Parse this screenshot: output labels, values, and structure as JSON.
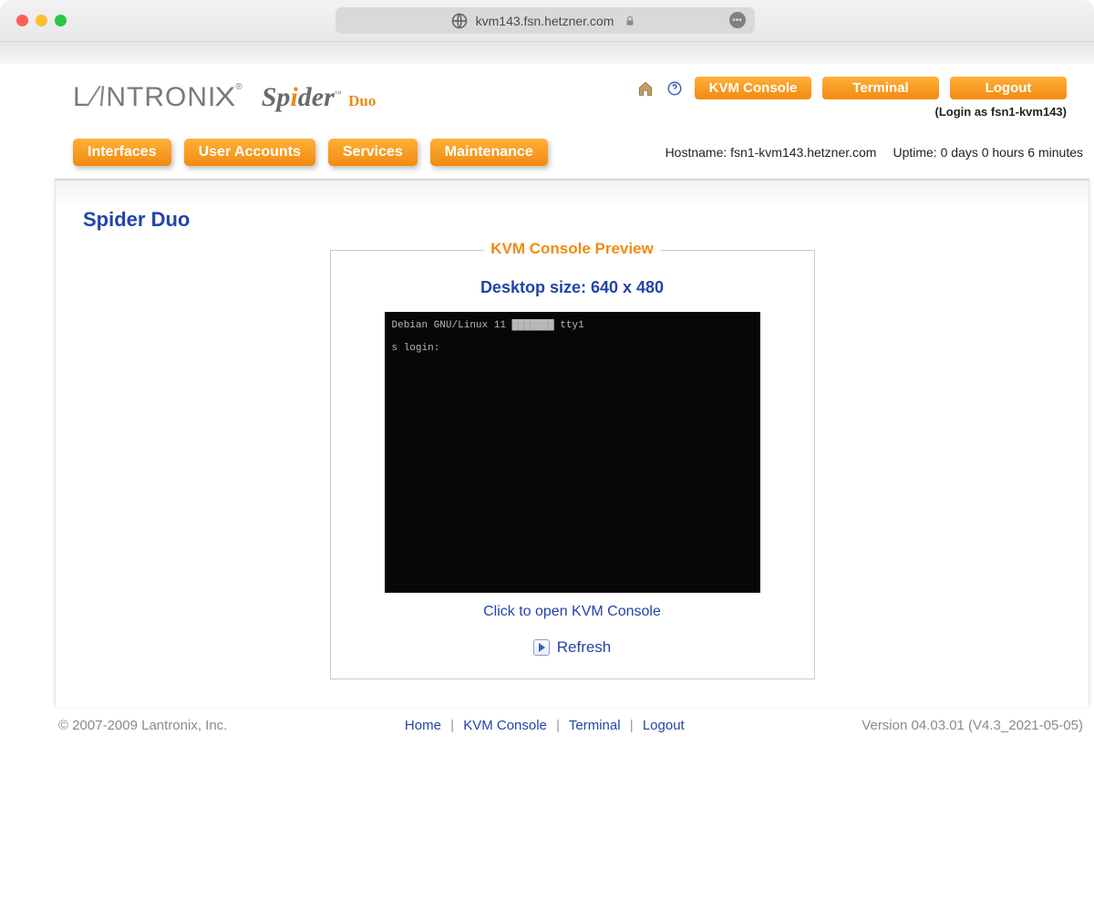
{
  "browser": {
    "url": "kvm143.fsn.hetzner.com"
  },
  "header": {
    "logo1": "LANTRONIX",
    "logo1_reg": "®",
    "logo2_pre": "Sp",
    "logo2_i": "i",
    "logo2_post": "der",
    "logo2_tm": "™",
    "logo2_suffix": "Duo",
    "buttons": {
      "kvm": "KVM Console",
      "terminal": "Terminal",
      "logout": "Logout"
    },
    "login_as": "(Login as fsn1-kvm143)"
  },
  "menu": {
    "items": [
      "Interfaces",
      "User Accounts",
      "Services",
      "Maintenance"
    ],
    "hostname_label": "Hostname:",
    "hostname_value": "fsn1-kvm143.hetzner.com",
    "uptime_label": "Uptime:",
    "uptime_value": "0 days 0 hours 6 minutes"
  },
  "content": {
    "page_title": "Spider Duo",
    "fieldset_legend": "KVM Console Preview",
    "desktop_size": "Desktop size: 640 x 480",
    "console_line1": "Debian GNU/Linux 11 ███████ tty1",
    "console_line2": "s login:",
    "open_link": "Click to open KVM Console",
    "refresh": "Refresh"
  },
  "footer": {
    "copyright": "© 2007-2009 Lantronix, Inc.",
    "links": {
      "home": "Home",
      "kvm": "KVM Console",
      "terminal": "Terminal",
      "logout": "Logout"
    },
    "version": "Version 04.03.01 (V4.3_2021-05-05)"
  }
}
